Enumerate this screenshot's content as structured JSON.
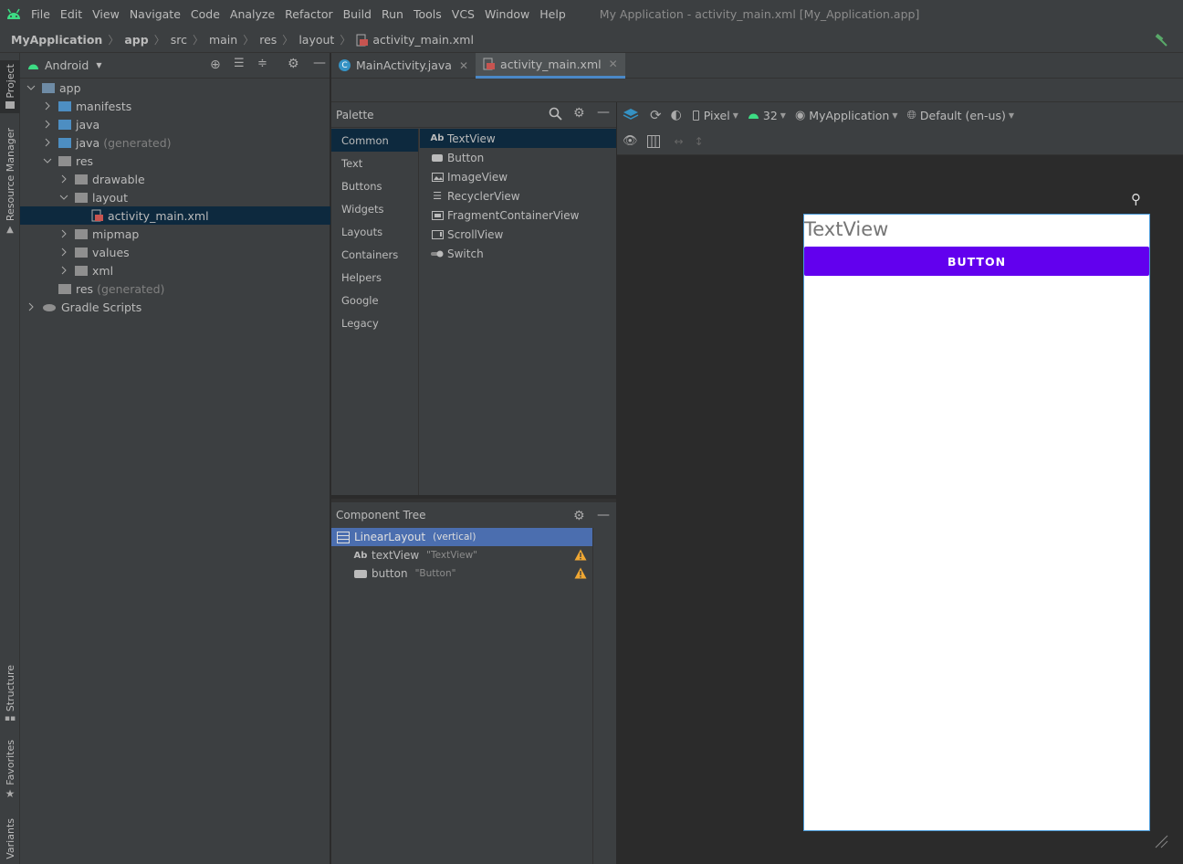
{
  "menu": [
    "File",
    "Edit",
    "View",
    "Navigate",
    "Code",
    "Analyze",
    "Refactor",
    "Build",
    "Run",
    "Tools",
    "VCS",
    "Window",
    "Help"
  ],
  "window_title": "My Application - activity_main.xml [My_Application.app]",
  "breadcrumb": [
    "MyApplication",
    "app",
    "src",
    "main",
    "res",
    "layout",
    "activity_main.xml"
  ],
  "left_tabs": [
    "Project",
    "Resource Manager",
    "Structure",
    "Favorites",
    "Variants"
  ],
  "project": {
    "view_mode": "Android",
    "tree": [
      {
        "label": "app",
        "extra": ""
      },
      {
        "label": "manifests",
        "extra": ""
      },
      {
        "label": "java",
        "extra": ""
      },
      {
        "label": "java",
        "extra": "(generated)"
      },
      {
        "label": "res",
        "extra": ""
      },
      {
        "label": "drawable",
        "extra": ""
      },
      {
        "label": "layout",
        "extra": ""
      },
      {
        "label": "activity_main.xml",
        "extra": ""
      },
      {
        "label": "mipmap",
        "extra": ""
      },
      {
        "label": "values",
        "extra": ""
      },
      {
        "label": "xml",
        "extra": ""
      },
      {
        "label": "res",
        "extra": "(generated)"
      },
      {
        "label": "Gradle Scripts",
        "extra": ""
      }
    ]
  },
  "tabs": [
    {
      "label": "MainActivity.java"
    },
    {
      "label": "activity_main.xml"
    }
  ],
  "palette": {
    "title": "Palette",
    "categories": [
      "Common",
      "Text",
      "Buttons",
      "Widgets",
      "Layouts",
      "Containers",
      "Helpers",
      "Google",
      "Legacy"
    ],
    "items": [
      "TextView",
      "Button",
      "ImageView",
      "RecyclerView",
      "FragmentContainerView",
      "ScrollView",
      "Switch"
    ],
    "textview_icon": "Ab"
  },
  "component_tree": {
    "title": "Component Tree",
    "root": {
      "label": "LinearLayout",
      "extra": "(vertical)"
    },
    "children": [
      {
        "icon": "Ab",
        "label": "textView",
        "extra": "\"TextView\""
      },
      {
        "icon": "",
        "label": "button",
        "extra": "\"Button\""
      }
    ]
  },
  "design_toolbar": {
    "device": "Pixel",
    "api": "32",
    "theme": "MyApplication",
    "locale": "Default (en-us)"
  },
  "preview": {
    "textview": "TextView",
    "button": "BUTTON"
  },
  "colors": {
    "accent_purple": "#6200ee",
    "selection_blue": "#4b6eaf",
    "android_green": "#3ddc84",
    "warning": "#f0a732"
  }
}
